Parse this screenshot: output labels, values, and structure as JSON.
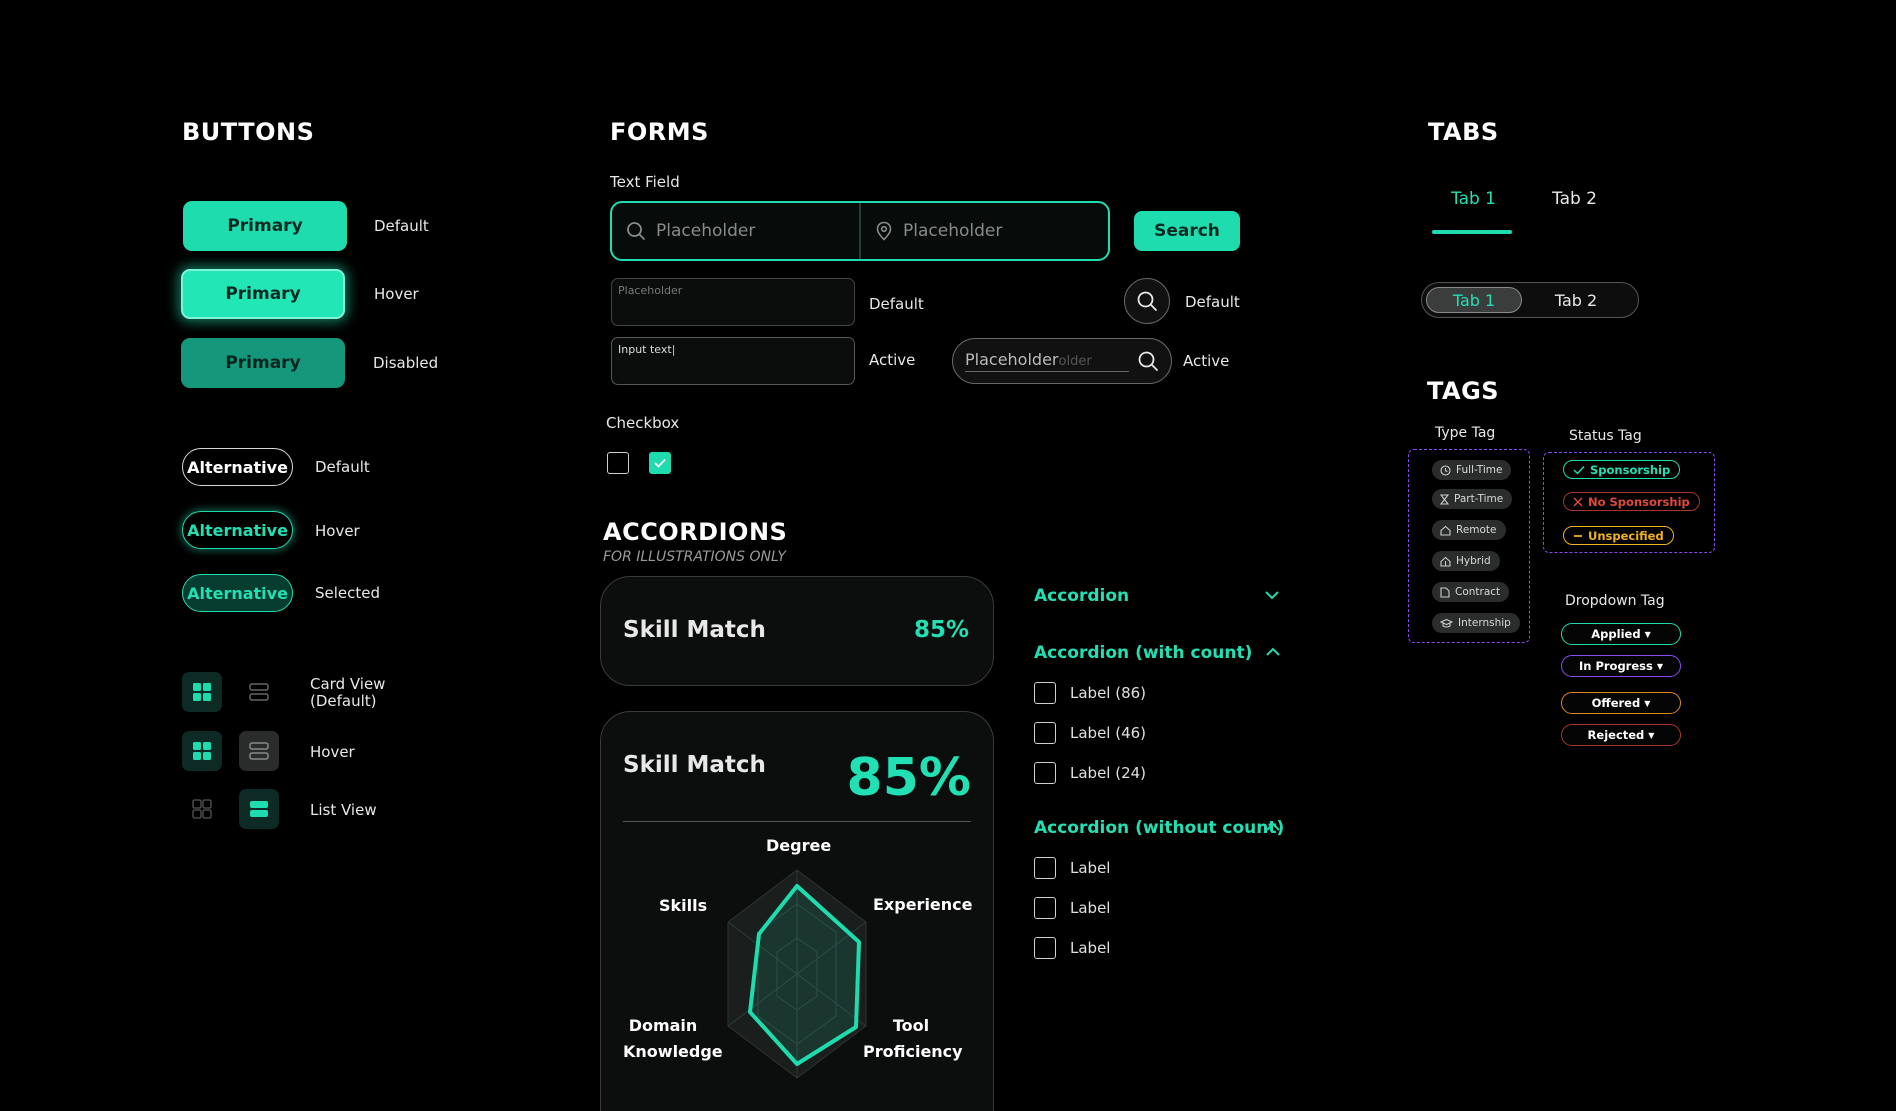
{
  "buttons": {
    "heading": "BUTTONS",
    "primary_label": "Primary",
    "states": {
      "default": "Default",
      "hover": "Hover",
      "disabled": "Disabled",
      "selected": "Selected"
    },
    "alternative_label": "Alternative",
    "view_states": {
      "card_view": "Card View",
      "card_view_default": "(Default)",
      "hover": "Hover",
      "list_view": "List View"
    }
  },
  "forms": {
    "heading": "FORMS",
    "text_field_label": "Text Field",
    "placeholder": "Placeholder",
    "search_button": "Search",
    "input_placeholder": "Placeholder",
    "input_active_text": "Input text",
    "state_default": "Default",
    "state_active": "Active",
    "pill_search_placeholder": "Placeholder",
    "pill_search_ghost": "older",
    "checkbox_label": "Checkbox"
  },
  "accordions": {
    "heading": "ACCORDIONS",
    "subheading": "FOR ILLUSTRATIONS ONLY",
    "skill_card_small": {
      "title": "Skill Match",
      "value": "85%"
    },
    "skill_card_large": {
      "title": "Skill Match",
      "value": "85%"
    },
    "radar_axes": {
      "degree": "Degree",
      "experience": "Experience",
      "skills": "Skills",
      "domain_knowledge_1": "Domain",
      "domain_knowledge_2": "Knowledge",
      "tool_proficiency_1": "Tool",
      "tool_proficiency_2": "Proficiency"
    },
    "accordion_plain": "Accordion",
    "accordion_with_count": {
      "title": "Accordion (with count)",
      "items": [
        "Label (86)",
        "Label (46)",
        "Label (24)"
      ]
    },
    "accordion_without_count": {
      "title": "Accordion (without count)",
      "items": [
        "Label",
        "Label",
        "Label"
      ]
    }
  },
  "tabs": {
    "heading": "TABS",
    "underline_tabs": [
      "Tab 1",
      "Tab 2"
    ],
    "pill_tabs": [
      "Tab 1",
      "Tab 2"
    ]
  },
  "tags": {
    "heading": "TAGS",
    "type_tag_label": "Type Tag",
    "type_tags": [
      "Full-Time",
      "Part-Time",
      "Remote",
      "Hybrid",
      "Contract",
      "Internship"
    ],
    "status_tag_label": "Status Tag",
    "status_tags": [
      "Sponsorship",
      "No Sponsorship",
      "Unspecified"
    ],
    "dropdown_tag_label": "Dropdown Tag",
    "dropdown_tags": [
      "Applied",
      "In Progress",
      "Offered",
      "Rejected"
    ]
  },
  "colors": {
    "accent": "#1fdcae",
    "background": "#000000",
    "purple_dash": "#8a4cf0",
    "error": "#e04a3c",
    "warning": "#f0b21f"
  }
}
